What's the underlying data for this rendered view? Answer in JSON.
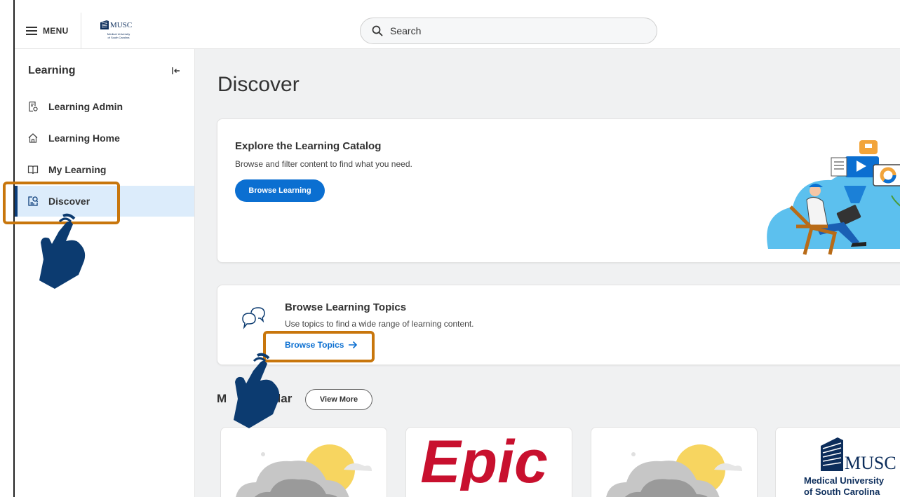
{
  "header": {
    "menu_label": "MENU",
    "logo": {
      "wordmark": "MUSC",
      "subtitle_1": "Medical University",
      "subtitle_2": "of South Carolina"
    },
    "search_placeholder": "Search"
  },
  "sidebar": {
    "title": "Learning",
    "items": [
      {
        "label": "Learning Admin",
        "icon": "admin-report-icon",
        "active": false
      },
      {
        "label": "Learning Home",
        "icon": "home-icon",
        "active": false
      },
      {
        "label": "My Learning",
        "icon": "book-icon",
        "active": false
      },
      {
        "label": "Discover",
        "icon": "discover-icon",
        "active": true
      }
    ]
  },
  "main": {
    "title": "Discover",
    "catalog_card": {
      "heading": "Explore the Learning Catalog",
      "description": "Browse and filter content to find what you need.",
      "button_label": "Browse Learning"
    },
    "topics_card": {
      "heading": "Browse Learning Topics",
      "description": "Use topics to find a wide range of learning content.",
      "link_label": "Browse Topics"
    },
    "popular": {
      "title_visible_left": "M",
      "title_visible_right": "ular",
      "view_more_label": "View More",
      "tiles": [
        {
          "kind": "weather-illustration"
        },
        {
          "kind": "epic-logo",
          "text": "Epic"
        },
        {
          "kind": "weather-illustration"
        },
        {
          "kind": "musc-logo",
          "wordmark": "MUSC",
          "line1": "Medical University",
          "line2": "of South Carolina"
        }
      ]
    }
  },
  "colors": {
    "accent_blue": "#0b6fd1",
    "nav_active_bg": "#dcecfb",
    "highlight_orange": "#c8760c",
    "hand_navy": "#0c3b70",
    "epic_red": "#c8102e"
  }
}
